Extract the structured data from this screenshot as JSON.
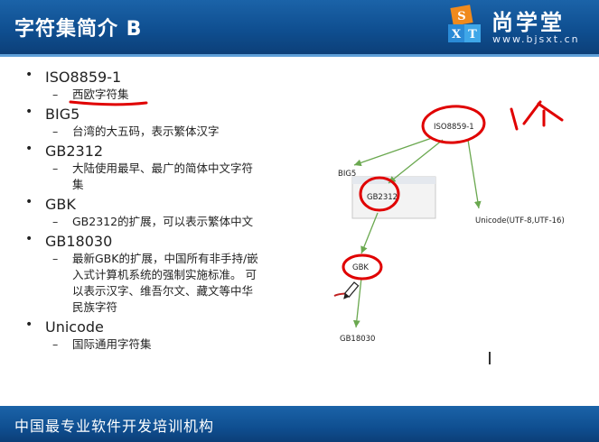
{
  "header": {
    "title": "字符集简介  B"
  },
  "logo": {
    "name": "尚学堂",
    "url": "www.bjsxt.cn",
    "mark": "SXT"
  },
  "list": [
    {
      "label": "ISO8859-1",
      "sub": "西欧字符集"
    },
    {
      "label": "BIG5",
      "sub": "台湾的大五码，表示繁体汉字"
    },
    {
      "label": "GB2312",
      "sub": "大陆使用最早、最广的简体中文字符集"
    },
    {
      "label": "GBK",
      "sub": "GB2312的扩展，可以表示繁体中文"
    },
    {
      "label": "GB18030",
      "sub": "最新GBK的扩展，中国所有非手持/嵌入式计算机系统的强制实施标准。 可以表示汉字、维吾尔文、藏文等中华民族字符"
    },
    {
      "label": "Unicode",
      "sub": "国际通用字符集"
    }
  ],
  "diagram": {
    "nodes": {
      "iso": "ISO8859-1",
      "big5": "BIG5",
      "gb2312": "GB2312",
      "unicode": "Unicode(UTF-8,UTF-16)",
      "gbk": "GBK",
      "gb18030": "GB18030"
    },
    "annotation": "1个"
  },
  "footer": {
    "text": "中国最专业软件开发培训机构"
  },
  "colors": {
    "header": "#0f4f91",
    "accent": "#5fa0d8",
    "arrow": "#6aa84f",
    "ink": "#e00000"
  }
}
